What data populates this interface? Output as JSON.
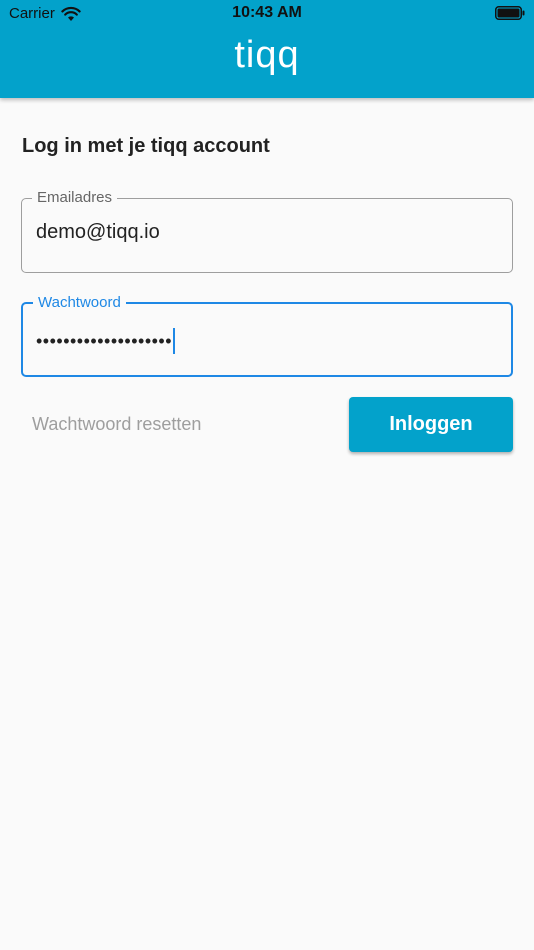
{
  "status_bar": {
    "carrier": "Carrier",
    "time": "10:43 AM"
  },
  "header": {
    "brand": "tiqq",
    "background_color": "#03a2cb"
  },
  "login": {
    "title": "Log in met je tiqq account",
    "email": {
      "label": "Emailadres",
      "value": "demo@tiqq.io"
    },
    "password": {
      "label": "Wachtwoord",
      "masked_value": "••••••••••••••••••••",
      "focus_color": "#1e88e5"
    },
    "reset_label": "Wachtwoord resetten",
    "login_label": "Inloggen"
  },
  "icons": {
    "wifi": "wifi-icon",
    "battery": "battery-icon"
  }
}
